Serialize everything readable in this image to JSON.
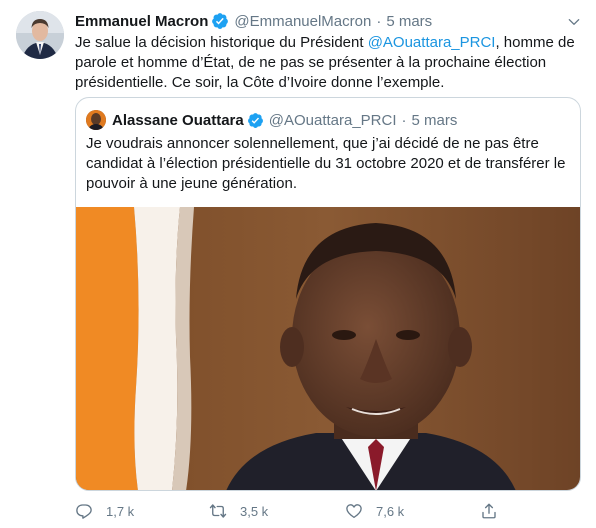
{
  "tweet": {
    "author_name": "Emmanuel Macron",
    "author_handle": "@EmmanuelMacron",
    "separator": "·",
    "date": "5 mars",
    "text_before": "Je salue la décision historique du Président ",
    "mention": "@AOuattara_PRCI",
    "text_after": ", homme de parole et homme d’État, de ne pas se présenter à la prochaine élection présidentielle. Ce soir, la Côte d’Ivoire donne l’exemple."
  },
  "quoted": {
    "author_name": "Alassane Ouattara",
    "author_handle": "@AOuattara_PRCI",
    "separator": "·",
    "date": "5 mars",
    "text": "Je voudrais annoncer solennellement, que j’ai décidé de ne pas être candidat à l’élection présidentielle du 31 octobre 2020 et de transférer le pouvoir à une jeune génération."
  },
  "actions": {
    "reply_count": "1,7 k",
    "retweet_count": "3,5 k",
    "like_count": "7,6 k"
  },
  "colors": {
    "accent": "#1da1f2",
    "link": "#1b95e0",
    "secondary_text": "#657786",
    "border": "#ccd6dd",
    "flag_orange": "#f77f00",
    "flag_white": "#ffffff"
  },
  "icons": [
    "verified-badge-icon",
    "chevron-down-icon",
    "reply-icon",
    "retweet-icon",
    "like-icon",
    "share-icon"
  ]
}
